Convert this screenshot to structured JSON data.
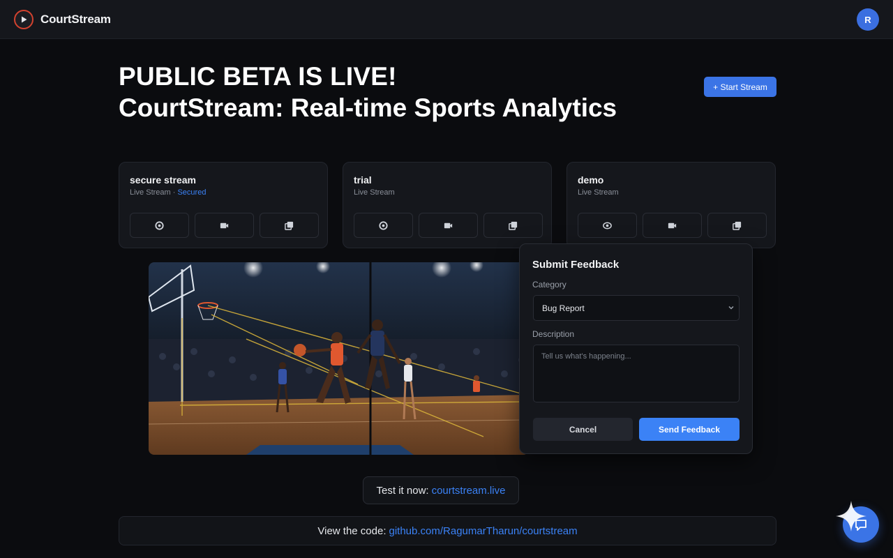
{
  "header": {
    "app_name": "CourtStream",
    "avatar_initial": "R"
  },
  "hero": {
    "line1": "PUBLIC BETA IS LIVE!",
    "line2": "CourtStream: Real-time Sports Analytics",
    "start_button": "+ Start Stream"
  },
  "streams": [
    {
      "title": "secure stream",
      "subtitle": "Live Stream · ",
      "badge": "Secured",
      "actions": [
        "eye-icon",
        "camera-icon",
        "copy-icon"
      ]
    },
    {
      "title": "trial",
      "subtitle": "Live Stream",
      "badge": "",
      "actions": [
        "eye-icon",
        "camera-icon",
        "copy-icon"
      ]
    },
    {
      "title": "demo",
      "subtitle": "Live Stream",
      "badge": "",
      "actions": [
        "eye-icon",
        "camera-icon",
        "copy-icon"
      ]
    }
  ],
  "feedback": {
    "title": "Submit Feedback",
    "category_label": "Category",
    "category_value": "Bug Report",
    "description_label": "Description",
    "description_placeholder": "Tell us what's happening...",
    "cancel_label": "Cancel",
    "send_label": "Send Feedback"
  },
  "footer": {
    "test_prefix": "Test it now:",
    "test_link": "courtstream.live",
    "code_prefix": "View the code:",
    "code_link": "github.com/RagumarTharun/courtstream"
  },
  "colors": {
    "accent": "#3b82f6",
    "brand_red": "#d2422f",
    "background": "#0b0c0f",
    "surface": "#15171c"
  }
}
